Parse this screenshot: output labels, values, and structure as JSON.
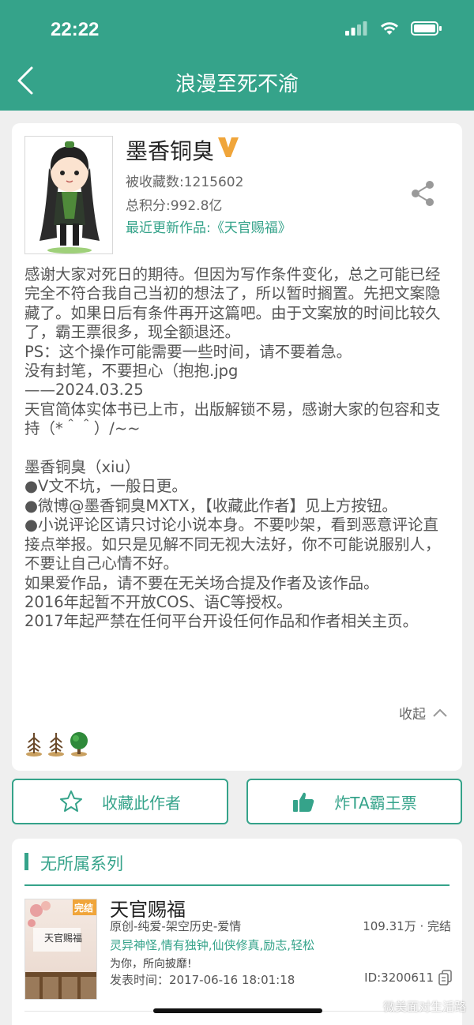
{
  "status_bar": {
    "time": "22:22"
  },
  "nav": {
    "title": "浪漫至死不渝"
  },
  "author": {
    "name": "墨香铜臭",
    "collected_label": "被收藏数:1215602",
    "score_label": "总积分:992.8亿",
    "latest_label": "最近更新作品:《天官赐福》"
  },
  "intro": "感谢大家对死日的期待。但因为写作条件变化，总之可能已经完全不符合我自己当初的想法了，所以暂时搁置。先把文案隐藏了。如果日后有条件再开这篇吧。由于文案放的时间比较久了，霸王票很多，现全额退还。\nPS：这个操作可能需要一些时间，请不要着急。\n没有封笔，不要担心（抱抱.jpg\n——2024.03.25\n天官简体实体书已上市，出版解锁不易，感谢大家的包容和支持（*＾＾）/~~\n\n墨香铜臭（xiu）\n●V文不坑，一般日更。\n●微博@墨香铜臭MXTX，【收藏此作者】见上方按钮。\n●小说评论区请只讨论小说本身。不要吵架，看到恶意评论直接点举报。如只是见解不同无视大法好，你不可能说服别人，不要让自己心情不好。\n如果爱作品，请不要在无关场合提及作者及该作品。\n2016年起暂不开放COS、语C等授权。\n2017年起严禁在任何平台开设任何作品和作者相关主页。",
  "collapse_label": "收起",
  "buttons": {
    "collect": "收藏此作者",
    "bawang": "炸TA霸王票"
  },
  "series": {
    "title": "无所属系列",
    "book": {
      "title": "天官赐福",
      "genre": "原创-纯爱-架空历史-爱情",
      "stats": "109.31万 · 完结",
      "tags": "灵异神怪,情有独钟,仙侠修真,励志,轻松",
      "desc": "为你，所向披靡!",
      "time": "发表时间：2017-06-16 18:01:18",
      "id": "ID:3200611",
      "cover_title": "天官赐福",
      "cover_badge": "完结"
    }
  },
  "watermark": "微美面对生活路",
  "colors": {
    "accent": "#35a38a",
    "badge": "#f0a53a"
  }
}
